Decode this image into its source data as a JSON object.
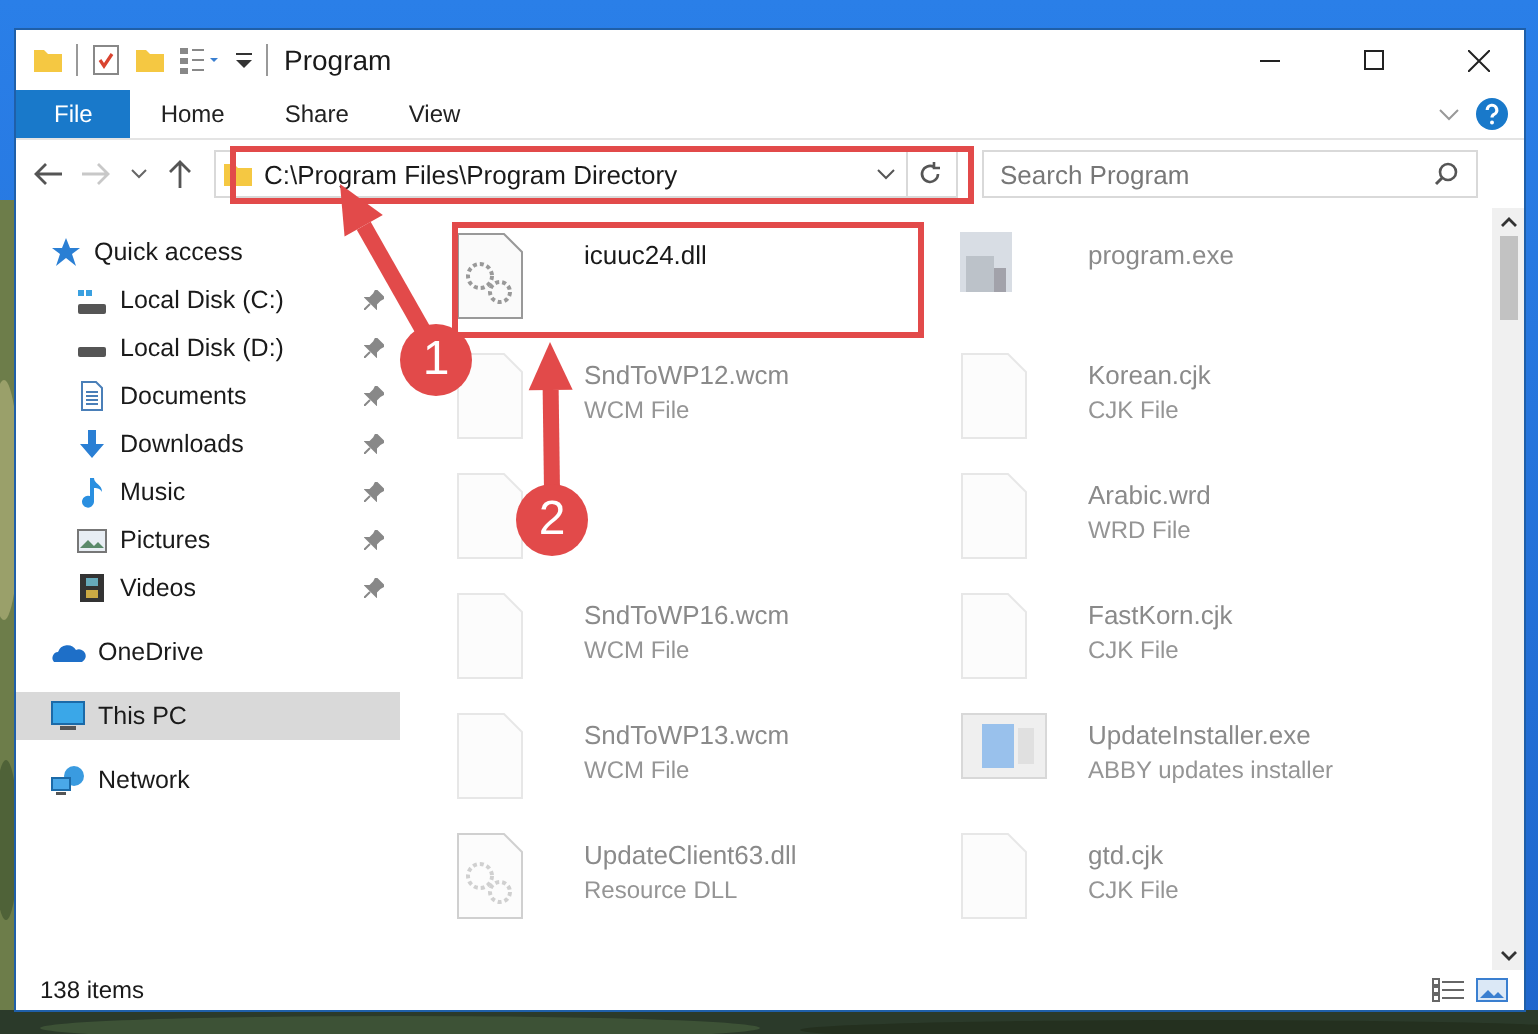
{
  "window": {
    "title": "Program"
  },
  "ribbon": {
    "tabs": [
      {
        "label": "File",
        "selected": true
      },
      {
        "label": "Home",
        "selected": false
      },
      {
        "label": "Share",
        "selected": false
      },
      {
        "label": "View",
        "selected": false
      }
    ]
  },
  "address_bar": {
    "path": "C:\\Program Files\\Program Directory"
  },
  "search": {
    "placeholder": "Search Program"
  },
  "sidebar": {
    "sections": [
      {
        "label": "Quick access",
        "kind": "star",
        "selected": false,
        "children": [
          {
            "label": "Local Disk (C:)",
            "kind": "drive-c",
            "pinned": true
          },
          {
            "label": "Local Disk (D:)",
            "kind": "drive",
            "pinned": true
          },
          {
            "label": "Documents",
            "kind": "documents",
            "pinned": true
          },
          {
            "label": "Downloads",
            "kind": "downloads",
            "pinned": true
          },
          {
            "label": "Music",
            "kind": "music",
            "pinned": true
          },
          {
            "label": "Pictures",
            "kind": "pictures",
            "pinned": true
          },
          {
            "label": "Videos",
            "kind": "videos",
            "pinned": true
          }
        ]
      },
      {
        "label": "OneDrive",
        "kind": "cloud",
        "selected": false
      },
      {
        "label": "This PC",
        "kind": "pc",
        "selected": true
      },
      {
        "label": "Network",
        "kind": "network",
        "selected": false
      }
    ]
  },
  "files": [
    {
      "name": "icuuc24.dll",
      "kind": "dll",
      "dimmed": false
    },
    {
      "name": "program.exe",
      "kind": "exe",
      "dimmed": true
    },
    {
      "name": "SndToWP12.wcm",
      "description": "WCM File",
      "kind": "doc",
      "dimmed": true
    },
    {
      "name": "Korean.cjk",
      "description": "CJK File",
      "kind": "doc",
      "dimmed": true
    },
    {
      "kind": "doc",
      "dimmed": true
    },
    {
      "name": "Arabic.wrd",
      "description": "WRD File",
      "kind": "doc",
      "dimmed": true
    },
    {
      "name": "SndToWP16.wcm",
      "description": "WCM File",
      "kind": "doc",
      "dimmed": true
    },
    {
      "name": "FastKorn.cjk",
      "description": "CJK File",
      "kind": "doc",
      "dimmed": true
    },
    {
      "name": "SndToWP13.wcm",
      "description": "WCM File",
      "kind": "doc",
      "dimmed": true
    },
    {
      "name": "UpdateInstaller.exe",
      "description": "ABBY updates installer",
      "kind": "installer",
      "dimmed": true
    },
    {
      "name": "UpdateClient63.dll",
      "description": "Resource DLL",
      "kind": "dll",
      "dimmed": true
    },
    {
      "name": "gtd.cjk",
      "description": "CJK File",
      "kind": "doc",
      "dimmed": true
    }
  ],
  "status_bar": {
    "item_count": "138 items"
  },
  "annotations": {
    "steps": [
      {
        "number": "1"
      },
      {
        "number": "2"
      }
    ]
  }
}
